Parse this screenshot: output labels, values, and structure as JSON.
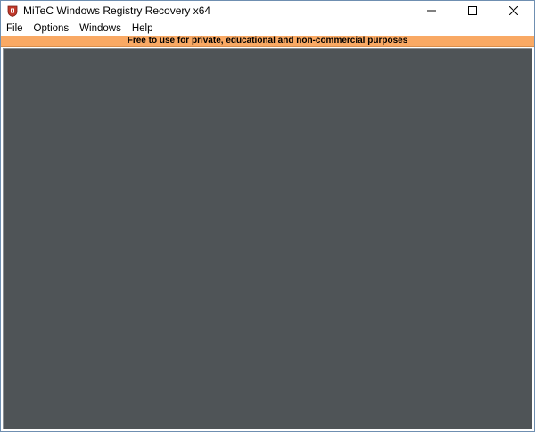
{
  "window": {
    "title": "MiTeC Windows Registry Recovery x64",
    "icon": "registry-app-icon"
  },
  "caption_buttons": {
    "minimize_icon": "minimize-icon",
    "maximize_icon": "maximize-icon",
    "close_icon": "close-icon"
  },
  "menu": {
    "items": [
      {
        "label": "File"
      },
      {
        "label": "Options"
      },
      {
        "label": "Windows"
      },
      {
        "label": "Help"
      }
    ]
  },
  "banner": {
    "text": "Free to use for private, educational and non-commercial  purposes",
    "color": "#f9a964"
  },
  "workspace": {
    "color": "#4f5457"
  }
}
